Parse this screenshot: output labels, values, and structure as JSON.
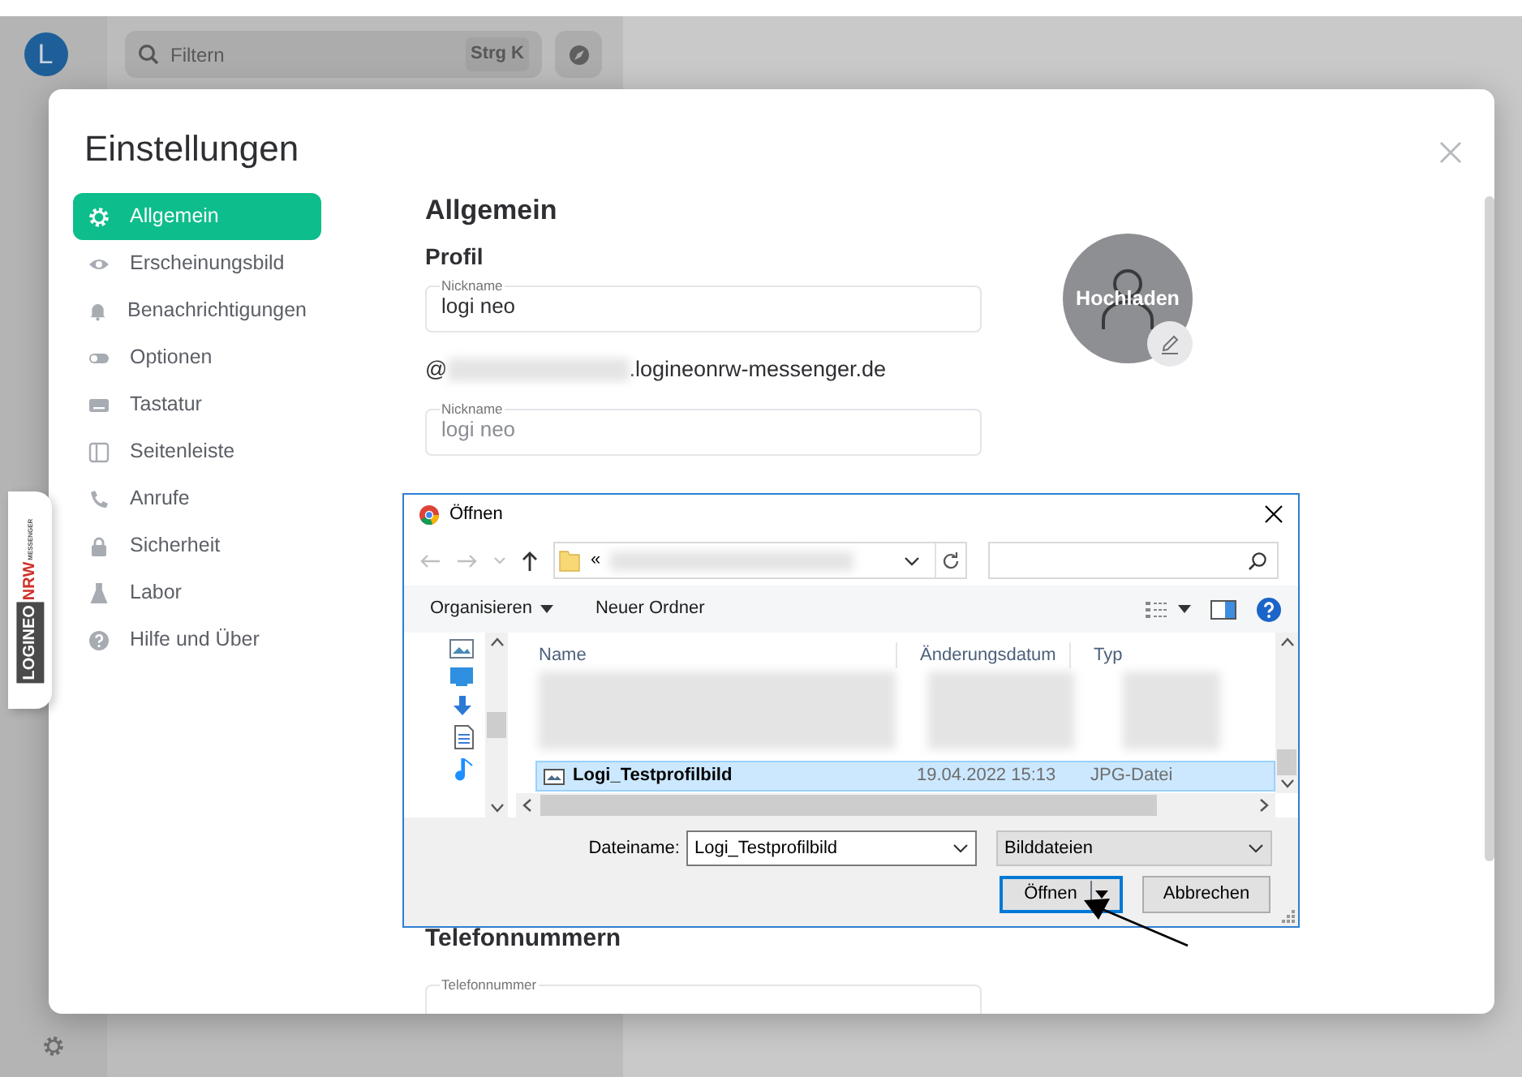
{
  "app": {
    "avatar": "L",
    "search": {
      "placeholder": "Filtern",
      "shortcut": "Strg K"
    }
  },
  "logo": {
    "words": [
      "LOGINEO",
      "NRW",
      "MESSENGER"
    ]
  },
  "settings": {
    "title": "Einstellungen",
    "nav": [
      {
        "label": "Allgemein",
        "selected": true
      },
      {
        "label": "Erscheinungsbild",
        "selected": false
      },
      {
        "label": "Benachrichtigungen",
        "selected": false
      },
      {
        "label": "Optionen",
        "selected": false
      },
      {
        "label": "Tastatur",
        "selected": false
      },
      {
        "label": "Seitenleiste",
        "selected": false
      },
      {
        "label": "Anrufe",
        "selected": false
      },
      {
        "label": "Sicherheit",
        "selected": false
      },
      {
        "label": "Labor",
        "selected": false
      },
      {
        "label": "Hilfe und Über",
        "selected": false
      }
    ],
    "heading": "Allgemein",
    "profile": {
      "title": "Profil",
      "display_name": {
        "label": "Nickname",
        "value": "logi neo"
      },
      "user_id": {
        "prefix": "@",
        "suffix": ".logineonrw-messenger.de"
      },
      "second_field": {
        "label": "Nickname",
        "placeholder": "logi neo"
      },
      "avatar_label": "Hochladen"
    },
    "phone": {
      "title": "Telefonnummern",
      "field_label": "Telefonnummer"
    }
  },
  "file_dialog": {
    "title": "Öffnen",
    "address": "«",
    "toolbar": [
      {
        "label": "Organisieren",
        "dropdown": true
      },
      {
        "label": "Neuer Ordner",
        "dropdown": false
      }
    ],
    "columns": [
      "Name",
      "Änderungsdatum",
      "Typ"
    ],
    "files": [
      {
        "name": "Logi_Testprofilbild",
        "date": "19.04.2022 15:13",
        "type": "JPG-Datei",
        "selected": true
      }
    ],
    "filename_label": "Dateiname:",
    "filename": "Logi_Testprofilbild",
    "filetype": "Bilddateien",
    "buttons": [
      {
        "label": "Öffnen",
        "default": true,
        "split": true
      },
      {
        "label": "Abbrechen",
        "default": false,
        "split": false
      }
    ]
  }
}
